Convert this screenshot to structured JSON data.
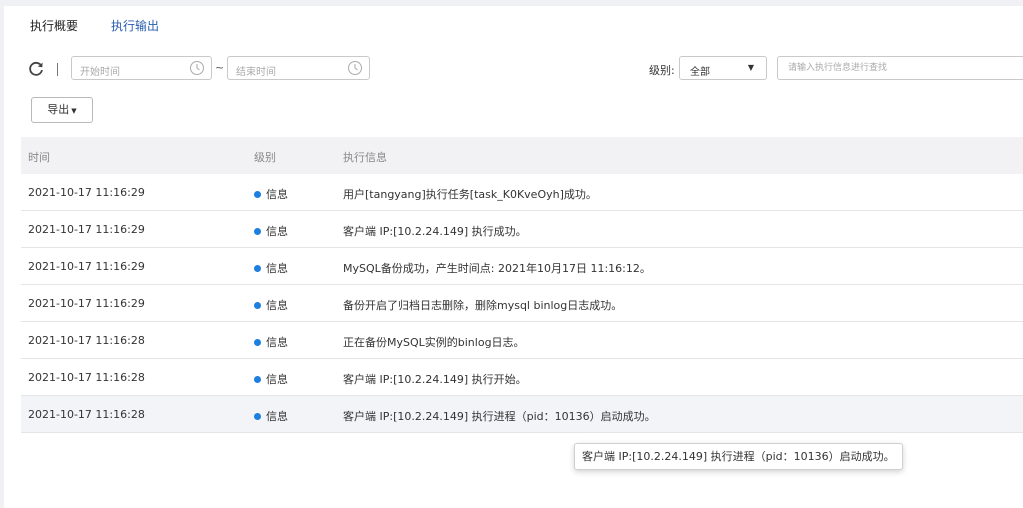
{
  "tabs": [
    {
      "label": "执行概要",
      "active": true
    },
    {
      "label": "执行输出",
      "active": false
    }
  ],
  "filters": {
    "start_placeholder": "开始时间",
    "separator": "~",
    "end_placeholder": "结束时间",
    "level_label": "级别:",
    "level_value": "全部",
    "search_placeholder": "请输入执行信息进行查找"
  },
  "export_label": "导出",
  "table": {
    "headers": {
      "time": "时间",
      "level": "级别",
      "message": "执行信息"
    },
    "rows": [
      {
        "time": "2021-10-17 11:16:29",
        "level": "信息",
        "message": "用户[tangyang]执行任务[task_K0KveOyh]成功。"
      },
      {
        "time": "2021-10-17 11:16:29",
        "level": "信息",
        "message": "客户端 IP:[10.2.24.149] 执行成功。"
      },
      {
        "time": "2021-10-17 11:16:29",
        "level": "信息",
        "message": "MySQL备份成功，产生时间点: 2021年10月17日 11:16:12。"
      },
      {
        "time": "2021-10-17 11:16:29",
        "level": "信息",
        "message": "备份开启了归档日志删除，删除mysql binlog日志成功。"
      },
      {
        "time": "2021-10-17 11:16:28",
        "level": "信息",
        "message": "正在备份MySQL实例的binlog日志。"
      },
      {
        "time": "2021-10-17 11:16:28",
        "level": "信息",
        "message": "客户端 IP:[10.2.24.149] 执行开始。"
      },
      {
        "time": "2021-10-17 11:16:28",
        "level": "信息",
        "message": "客户端 IP:[10.2.24.149] 执行进程（pid：10136）启动成功。"
      }
    ]
  },
  "tooltip": "客户端 IP:[10.2.24.149] 执行进程（pid：10136）启动成功。",
  "colors": {
    "info_dot": "#1d7fe0",
    "link": "#2a5db0"
  }
}
